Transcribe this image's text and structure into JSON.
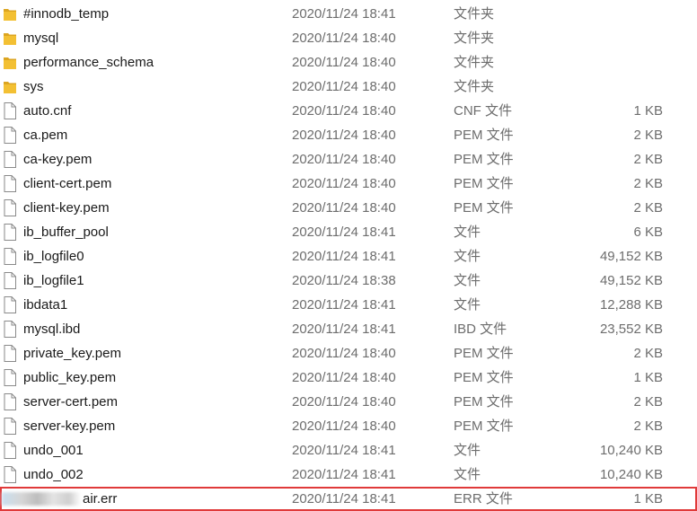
{
  "rows": [
    {
      "name": "#innodb_temp",
      "date": "2020/11/24 18:41",
      "type": "文件夹",
      "size": "",
      "icon": "folder-icon"
    },
    {
      "name": "mysql",
      "date": "2020/11/24 18:40",
      "type": "文件夹",
      "size": "",
      "icon": "folder-icon"
    },
    {
      "name": "performance_schema",
      "date": "2020/11/24 18:40",
      "type": "文件夹",
      "size": "",
      "icon": "folder-icon"
    },
    {
      "name": "sys",
      "date": "2020/11/24 18:40",
      "type": "文件夹",
      "size": "",
      "icon": "folder-icon"
    },
    {
      "name": "auto.cnf",
      "date": "2020/11/24 18:40",
      "type": "CNF 文件",
      "size": "1 KB",
      "icon": "file-icon"
    },
    {
      "name": "ca.pem",
      "date": "2020/11/24 18:40",
      "type": "PEM 文件",
      "size": "2 KB",
      "icon": "file-icon"
    },
    {
      "name": "ca-key.pem",
      "date": "2020/11/24 18:40",
      "type": "PEM 文件",
      "size": "2 KB",
      "icon": "file-icon"
    },
    {
      "name": "client-cert.pem",
      "date": "2020/11/24 18:40",
      "type": "PEM 文件",
      "size": "2 KB",
      "icon": "file-icon"
    },
    {
      "name": "client-key.pem",
      "date": "2020/11/24 18:40",
      "type": "PEM 文件",
      "size": "2 KB",
      "icon": "file-icon"
    },
    {
      "name": "ib_buffer_pool",
      "date": "2020/11/24 18:41",
      "type": "文件",
      "size": "6 KB",
      "icon": "file-icon"
    },
    {
      "name": "ib_logfile0",
      "date": "2020/11/24 18:41",
      "type": "文件",
      "size": "49,152 KB",
      "icon": "file-icon"
    },
    {
      "name": "ib_logfile1",
      "date": "2020/11/24 18:38",
      "type": "文件",
      "size": "49,152 KB",
      "icon": "file-icon"
    },
    {
      "name": "ibdata1",
      "date": "2020/11/24 18:41",
      "type": "文件",
      "size": "12,288 KB",
      "icon": "file-icon"
    },
    {
      "name": "mysql.ibd",
      "date": "2020/11/24 18:41",
      "type": "IBD 文件",
      "size": "23,552 KB",
      "icon": "file-icon"
    },
    {
      "name": "private_key.pem",
      "date": "2020/11/24 18:40",
      "type": "PEM 文件",
      "size": "2 KB",
      "icon": "file-icon"
    },
    {
      "name": "public_key.pem",
      "date": "2020/11/24 18:40",
      "type": "PEM 文件",
      "size": "1 KB",
      "icon": "file-icon"
    },
    {
      "name": "server-cert.pem",
      "date": "2020/11/24 18:40",
      "type": "PEM 文件",
      "size": "2 KB",
      "icon": "file-icon"
    },
    {
      "name": "server-key.pem",
      "date": "2020/11/24 18:40",
      "type": "PEM 文件",
      "size": "2 KB",
      "icon": "file-icon"
    },
    {
      "name": "undo_001",
      "date": "2020/11/24 18:41",
      "type": "文件",
      "size": "10,240 KB",
      "icon": "file-icon"
    },
    {
      "name": "undo_002",
      "date": "2020/11/24 18:41",
      "type": "文件",
      "size": "10,240 KB",
      "icon": "file-icon"
    }
  ],
  "highlighted_row": {
    "name": "air.err",
    "date": "2020/11/24 18:41",
    "type": "ERR 文件",
    "size": "1 KB",
    "icon": "blurred-file-icon"
  },
  "colors": {
    "folder": "#f3c033",
    "folder_shade": "#dca521",
    "highlight_border": "#e03a3a",
    "secondary_text": "#6d6d6d"
  }
}
